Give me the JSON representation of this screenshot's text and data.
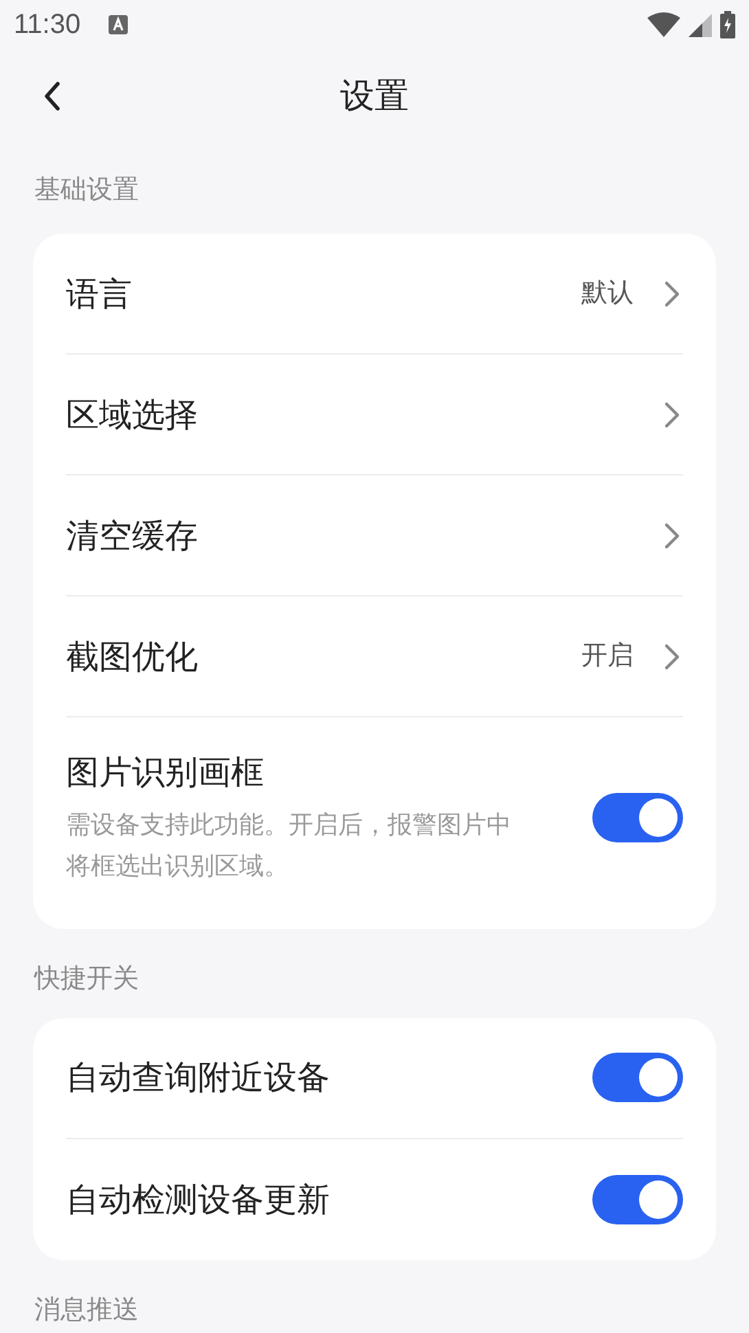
{
  "status_bar": {
    "time": "11:30"
  },
  "header": {
    "title": "设置"
  },
  "sections": [
    {
      "title": "基础设置",
      "items": [
        {
          "kind": "link",
          "label": "语言",
          "value": "默认"
        },
        {
          "kind": "link",
          "label": "区域选择"
        },
        {
          "kind": "link",
          "label": "清空缓存"
        },
        {
          "kind": "link",
          "label": "截图优化",
          "value": "开启"
        },
        {
          "kind": "toggle",
          "label": "图片识别画框",
          "description": "需设备支持此功能。开启后，报警图片中将框选出识别区域。",
          "on": true
        }
      ]
    },
    {
      "title": "快捷开关",
      "items": [
        {
          "kind": "toggle",
          "label": "自动查询附近设备",
          "on": true
        },
        {
          "kind": "toggle",
          "label": "自动检测设备更新",
          "on": true
        }
      ]
    },
    {
      "title": "消息推送"
    }
  ]
}
